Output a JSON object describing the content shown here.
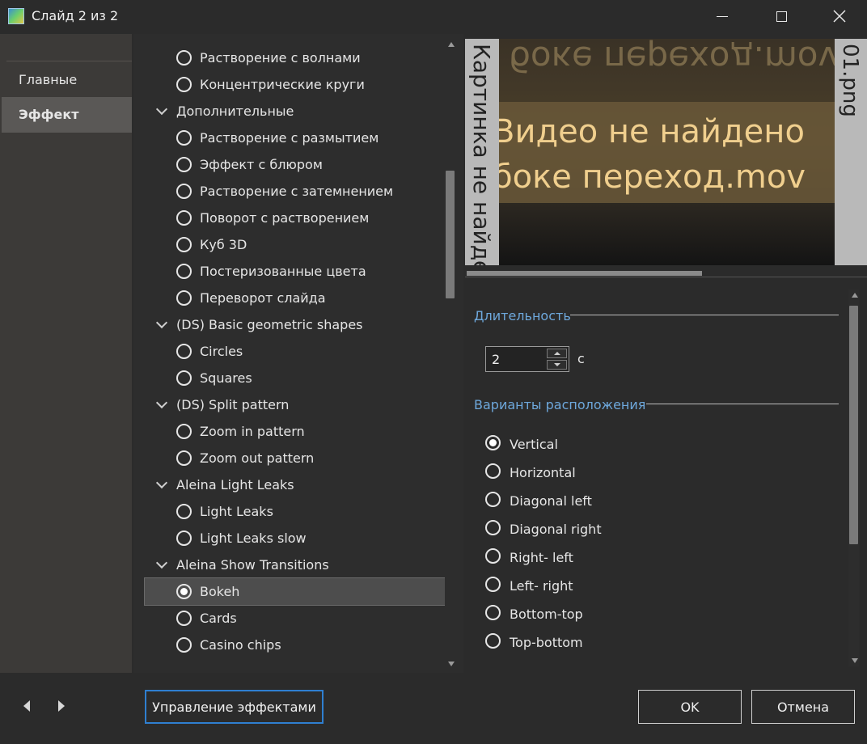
{
  "window": {
    "title": "Слайд 2 из 2",
    "icon": "app-icon",
    "controls": [
      "minimize-icon",
      "maximize-icon",
      "close-icon"
    ]
  },
  "nav": {
    "items": [
      {
        "label": "Главные",
        "active": false
      },
      {
        "label": "Эффект",
        "active": true
      }
    ]
  },
  "tree": {
    "rows": [
      {
        "type": "item",
        "label": "Растворение с волнами",
        "selected": false
      },
      {
        "type": "item",
        "label": "Концентрические круги",
        "selected": false
      },
      {
        "type": "group",
        "label": "Дополнительные"
      },
      {
        "type": "item",
        "label": "Растворение с размытием",
        "selected": false
      },
      {
        "type": "item",
        "label": "Эффект с блюром",
        "selected": false
      },
      {
        "type": "item",
        "label": "Растворение с затемнением",
        "selected": false
      },
      {
        "type": "item",
        "label": "Поворот с растворением",
        "selected": false
      },
      {
        "type": "item",
        "label": "Куб 3D",
        "selected": false
      },
      {
        "type": "item",
        "label": "Постеризованные цвета",
        "selected": false
      },
      {
        "type": "item",
        "label": "Переворот слайда",
        "selected": false
      },
      {
        "type": "group",
        "label": "(DS) Basic geometric shapes"
      },
      {
        "type": "item",
        "label": "Circles",
        "selected": false
      },
      {
        "type": "item",
        "label": "Squares",
        "selected": false
      },
      {
        "type": "group",
        "label": "(DS) Split pattern"
      },
      {
        "type": "item",
        "label": "Zoom in pattern",
        "selected": false
      },
      {
        "type": "item",
        "label": "Zoom out pattern",
        "selected": false
      },
      {
        "type": "group",
        "label": "Aleina Light Leaks"
      },
      {
        "type": "item",
        "label": "Light Leaks",
        "selected": false
      },
      {
        "type": "item",
        "label": "Light Leaks slow",
        "selected": false
      },
      {
        "type": "group",
        "label": "Aleina Show Transitions"
      },
      {
        "type": "item",
        "label": "Bokeh",
        "selected": true
      },
      {
        "type": "item",
        "label": "Cards",
        "selected": false
      },
      {
        "type": "item",
        "label": "Casino chips",
        "selected": false
      }
    ]
  },
  "preview": {
    "left_placeholder": "Картинка не найдена",
    "right_placeholder": "01.png",
    "text_line1": "Видео не найдено",
    "text_line2": "боке переход.mov",
    "mirror_text": "боке переход.mov"
  },
  "settings": {
    "duration": {
      "title": "Длительность",
      "value": "2",
      "unit": "с"
    },
    "layout": {
      "title": "Варианты расположения",
      "options": [
        {
          "label": "Vertical",
          "selected": true
        },
        {
          "label": "Horizontal",
          "selected": false
        },
        {
          "label": "Diagonal left",
          "selected": false
        },
        {
          "label": "Diagonal right",
          "selected": false
        },
        {
          "label": "Right- left",
          "selected": false
        },
        {
          "label": "Left- right",
          "selected": false
        },
        {
          "label": "Bottom-top",
          "selected": false
        },
        {
          "label": "Top-bottom",
          "selected": false
        }
      ]
    }
  },
  "footer": {
    "manage_label": "Управление эффектами",
    "ok_label": "OK",
    "cancel_label": "Отмена"
  },
  "colors": {
    "accent": "#6ea8dc",
    "focus_border": "#2f7fd0",
    "selection_bg": "#4d4d4d",
    "window_bg": "#2b2b2b"
  }
}
